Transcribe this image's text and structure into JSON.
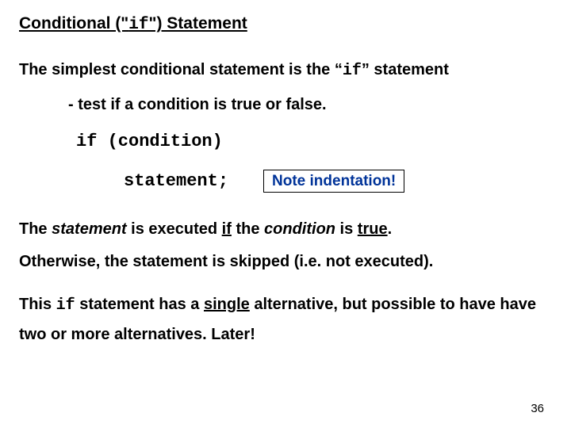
{
  "heading": {
    "pre": "Conditional (\"",
    "code": "if",
    "post": "\") Statement"
  },
  "line1": {
    "pre": "The simplest conditional statement is the “",
    "code": "if",
    "post": "” statement"
  },
  "line2": "- test if a condition is true or false.",
  "code": {
    "row1": "if (condition)",
    "row2": "statement;"
  },
  "note": "Note indentation!",
  "para1": {
    "t1": "The ",
    "stmt": "statement",
    "t2": " is executed ",
    "if_word": "if",
    "t3": " the ",
    "cond": "condition",
    "t4": " is ",
    "true_word": "true",
    "t5": "."
  },
  "para2": "Otherwise, the statement is skipped (i.e. not executed).",
  "para3": {
    "t1": "This ",
    "code": "if",
    "t2": " statement has a ",
    "single": "single",
    "t3": " alternative, but possible to have have two or more alternatives. Later!"
  },
  "page_number": "36"
}
